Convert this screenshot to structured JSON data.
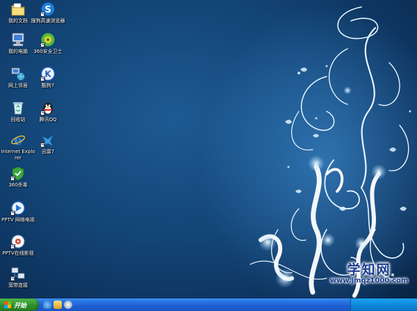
{
  "desktop_icons": [
    {
      "label": "我的文档",
      "icon": "my-documents-icon"
    },
    {
      "label": "我的电脑",
      "icon": "my-computer-icon"
    },
    {
      "label": "网上邻居",
      "icon": "network-places-icon"
    },
    {
      "label": "回收站",
      "icon": "recycle-bin-icon"
    },
    {
      "label": "Internet Explorer",
      "icon": "internet-explorer-icon"
    },
    {
      "label": "360杀毒",
      "icon": "360-antivirus-icon"
    },
    {
      "label": "PPTV 网络电视",
      "icon": "pptv-icon"
    },
    {
      "label": "PPTV在线影视",
      "icon": "pptv-online-icon"
    },
    {
      "label": "宽带连接",
      "icon": "broadband-connection-icon"
    },
    {
      "label": "搜狗高速浏览器",
      "icon": "sogou-browser-icon"
    },
    {
      "label": "360安全卫士",
      "icon": "360-safe-icon"
    },
    {
      "label": "酷狗7",
      "icon": "kugou-icon"
    },
    {
      "label": "腾讯QQ",
      "icon": "qq-penguin-icon"
    },
    {
      "label": "迅雷7",
      "icon": "xunlei-icon"
    }
  ],
  "taskbar": {
    "start_label": "开始",
    "quick_launch": [
      "ie-quicklaunch-icon",
      "folder-quicklaunch-icon",
      "media-quicklaunch-icon"
    ]
  },
  "watermark": {
    "title": "学知网",
    "url": "www.jmqz1000.com"
  },
  "colors": {
    "taskbar": "#2a77e4",
    "start_button": "#2f8f2b",
    "desktop": "#134577"
  }
}
